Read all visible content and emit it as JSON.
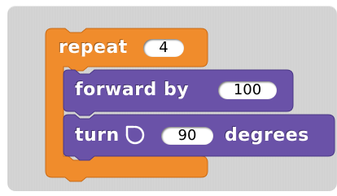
{
  "script": {
    "repeat_block": {
      "keyword": "repeat",
      "count": "4",
      "color": "#f08c2c"
    },
    "forward_block": {
      "keyword": "forward by",
      "distance": "100",
      "color": "#6a52a8"
    },
    "turn_block": {
      "keyword": "turn",
      "icon": "rotate-counterclockwise-icon",
      "angle": "90",
      "unit": "degrees",
      "color": "#6a52a8"
    }
  }
}
